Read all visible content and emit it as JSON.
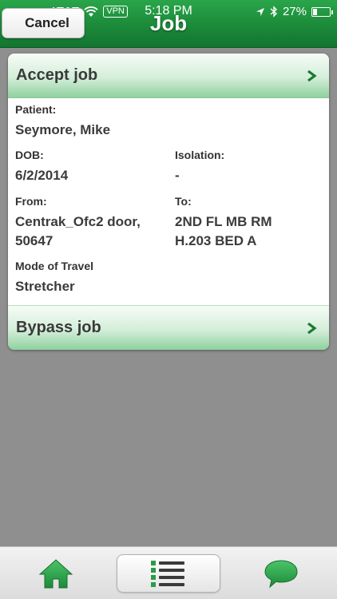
{
  "status_bar": {
    "carrier": "AT&T",
    "vpn": "VPN",
    "time": "5:18 PM",
    "battery": "27%",
    "battery_level": 0.27
  },
  "header": {
    "title": "Job",
    "cancel_label": "Cancel"
  },
  "actions": {
    "accept_label": "Accept job",
    "bypass_label": "Bypass job"
  },
  "job": {
    "patient_label": "Patient:",
    "patient_value": "Seymore, Mike",
    "dob_label": "DOB:",
    "dob_value": "6/2/2014",
    "isolation_label": "Isolation:",
    "isolation_value": "-",
    "from_label": "From:",
    "from_line1": "Centrak_Ofc2 door,",
    "from_line2": "50647",
    "to_label": "To:",
    "to_line1": "2ND FL MB RM",
    "to_line2": "H.203 BED A",
    "mode_label": "Mode of Travel",
    "mode_value": "Stretcher"
  },
  "tabbar": {
    "items": [
      {
        "icon": "home-icon"
      },
      {
        "icon": "list-icon",
        "selected": true
      },
      {
        "icon": "chat-bubble-icon"
      }
    ]
  },
  "colors": {
    "brand_green": "#1b8a39",
    "accent_green": "#2aa54a"
  }
}
